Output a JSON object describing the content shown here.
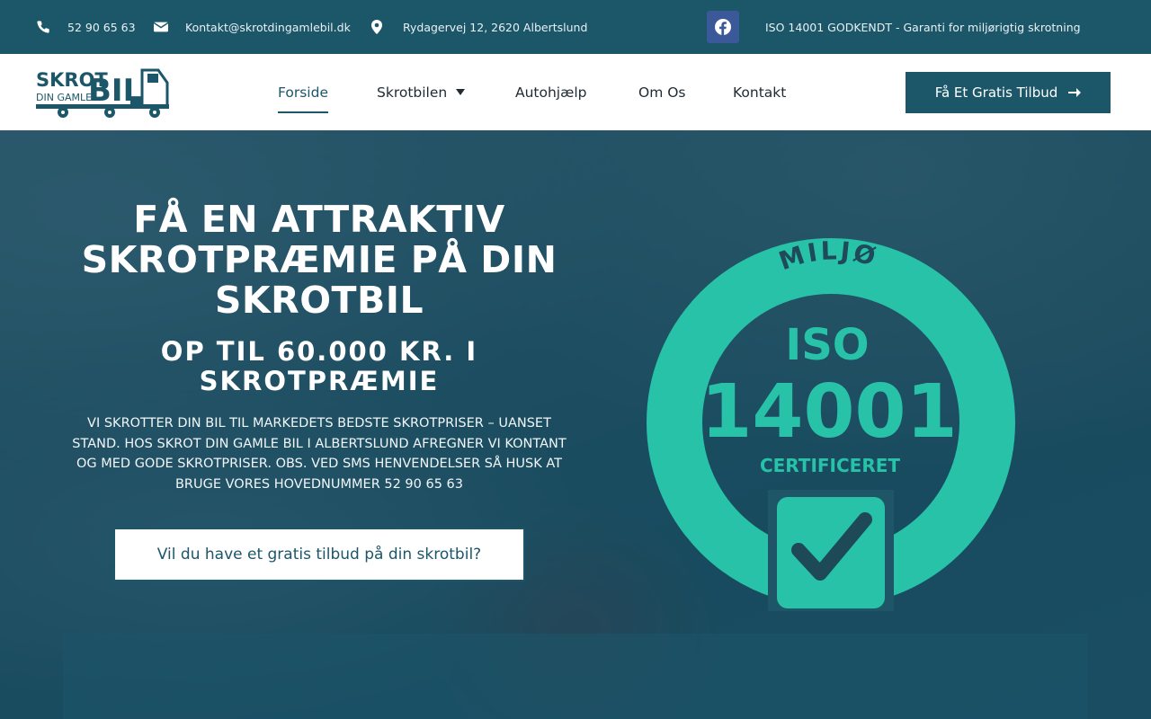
{
  "topbar": {
    "phone": "52 90 65 63",
    "email": "Kontakt@skrotdingamlebil.dk",
    "address": "Rydagervej 12, 2620 Albertslund",
    "iso_notice": "ISO 14001 GODKENDT - Garanti for miljørigtig skrotning",
    "facebook_icon": "facebook-icon"
  },
  "logo": {
    "word_top": "SKROT",
    "word_sub": "DIN GAMLE",
    "word_big": "BIL"
  },
  "nav": {
    "items": [
      {
        "label": "Forside",
        "active": true
      },
      {
        "label": "Skrotbilen",
        "has_dropdown": true
      },
      {
        "label": "Autohjælp"
      },
      {
        "label": "Om Os"
      },
      {
        "label": "Kontakt"
      }
    ],
    "cta_label": "Få Et Gratis Tilbud"
  },
  "hero": {
    "headline": "FÅ EN ATTRAKTIV SKROTPRÆMIE PÅ DIN SKROTBIL",
    "subheadline": "OP TIL 60.000 KR. I SKROTPRÆMIE",
    "body": "VI SKROTTER DIN BIL TIL MARKEDETS BEDSTE SKROTPRISER – UANSET STAND. HOS SKROT DIN GAMLE BIL I ALBERTSLUND AFREGNER VI KONTANT OG MED GODE SKROTPRISER. OBS. VED SMS HENVENDELSER SÅ HUSK AT BRUGE VORES HOVEDNUMMER 52 90 65 63",
    "button_label": "Vil du have et gratis tilbud på din skrotbil?"
  },
  "badge": {
    "top_word": "MILJØ",
    "iso": "ISO",
    "number": "14001",
    "certified": "CERTIFICERET"
  },
  "colors": {
    "brand": "#1c5669",
    "badge_green": "#27c2a8",
    "facebook": "#3b5998"
  }
}
